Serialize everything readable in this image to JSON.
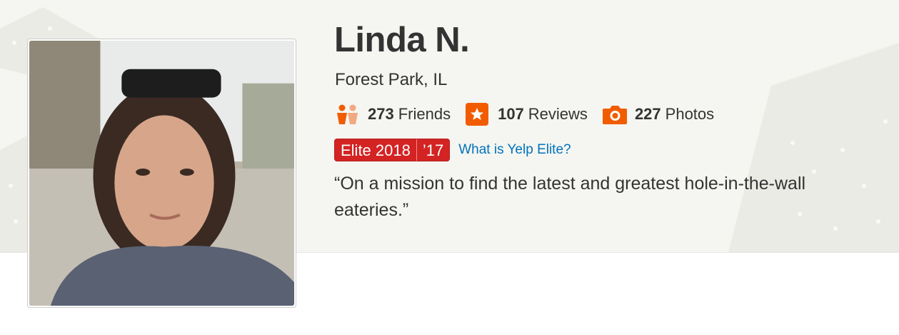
{
  "profile": {
    "name": "Linda N.",
    "location": "Forest Park, IL",
    "photo_alt": "Photo of Linda N."
  },
  "stats": {
    "friends": {
      "count": "273",
      "label": "Friends",
      "icon": "friends-icon"
    },
    "reviews": {
      "count": "107",
      "label": "Reviews",
      "icon": "star-icon"
    },
    "photos": {
      "count": "227",
      "label": "Photos",
      "icon": "camera-icon"
    }
  },
  "elite": {
    "badges": [
      "Elite 2018",
      "’17"
    ],
    "link_label": "What is Yelp Elite?"
  },
  "tagline": "“On a mission to find the latest and greatest hole-in-the-wall eateries.”",
  "colors": {
    "banner_bg": "#f5f5f1",
    "elite_red": "#d32323",
    "icon_orange": "#f15c00",
    "link_blue": "#0073bb",
    "text": "#333333"
  }
}
